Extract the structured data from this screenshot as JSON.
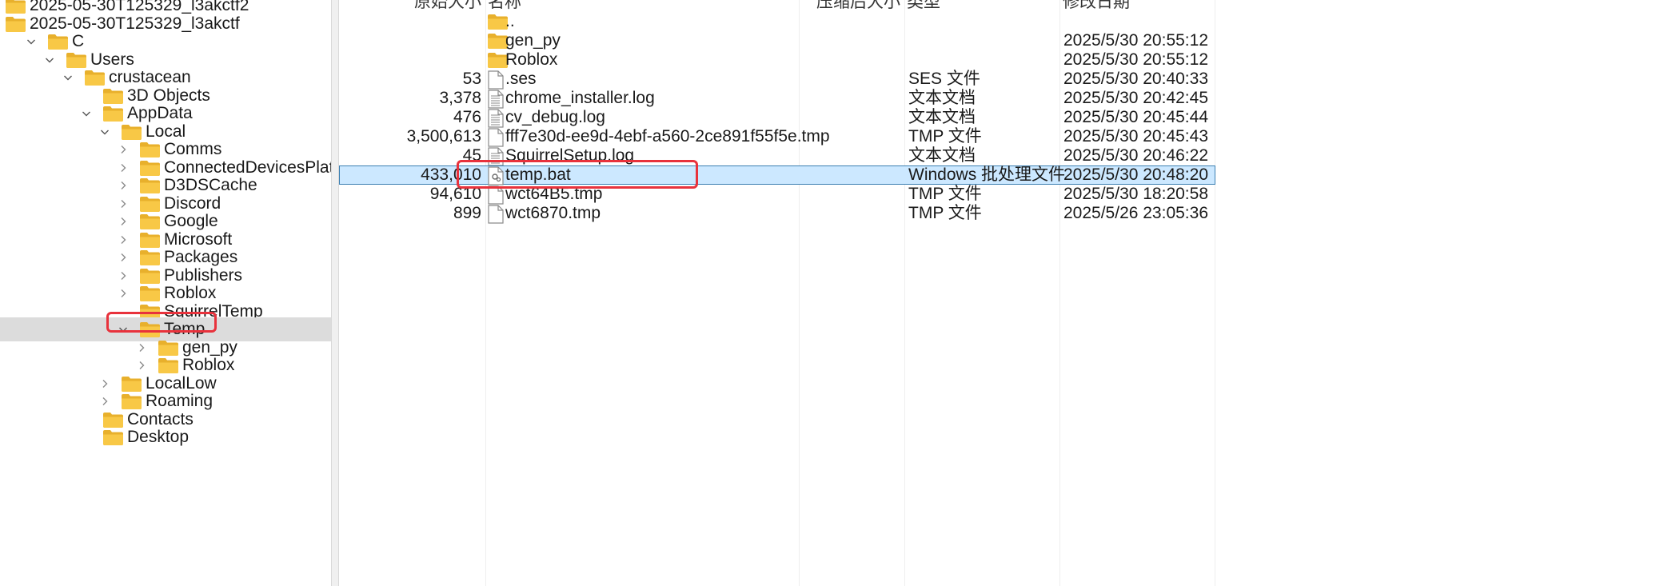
{
  "tree": {
    "items": [
      {
        "label": "2025-05-30T125329_l3akctf2",
        "expand": "none"
      },
      {
        "label": "2025-05-30T125329_l3akctf",
        "expand": "none"
      },
      {
        "label": "C",
        "expand": "open"
      },
      {
        "label": "Users",
        "expand": "open"
      },
      {
        "label": "crustacean",
        "expand": "open"
      },
      {
        "label": "3D Objects",
        "expand": "none"
      },
      {
        "label": "AppData",
        "expand": "open"
      },
      {
        "label": "Local",
        "expand": "open"
      },
      {
        "label": "Comms",
        "expand": "closed"
      },
      {
        "label": "ConnectedDevicesPlatform",
        "expand": "closed"
      },
      {
        "label": "D3DSCache",
        "expand": "closed"
      },
      {
        "label": "Discord",
        "expand": "closed"
      },
      {
        "label": "Google",
        "expand": "closed"
      },
      {
        "label": "Microsoft",
        "expand": "closed"
      },
      {
        "label": "Packages",
        "expand": "closed"
      },
      {
        "label": "Publishers",
        "expand": "closed"
      },
      {
        "label": "Roblox",
        "expand": "closed"
      },
      {
        "label": "SquirrelTemp",
        "expand": "none"
      },
      {
        "label": "Temp",
        "expand": "open"
      },
      {
        "label": "gen_py",
        "expand": "closed"
      },
      {
        "label": "Roblox",
        "expand": "closed"
      },
      {
        "label": "LocalLow",
        "expand": "closed"
      },
      {
        "label": "Roaming",
        "expand": "closed"
      },
      {
        "label": "Contacts",
        "expand": "none"
      },
      {
        "label": "Desktop",
        "expand": "none"
      }
    ]
  },
  "list": {
    "headers": {
      "orig_size": "原始大小",
      "name": "名称",
      "comp_size": "压缩后大小",
      "type": "类型",
      "modified": "修改日期"
    },
    "rows": [
      {
        "size": "",
        "name": "..",
        "icon": "folder-icon",
        "type": "",
        "modified": ""
      },
      {
        "size": "",
        "name": "gen_py",
        "icon": "folder-icon",
        "type": "",
        "modified": "2025/5/30 20:55:12"
      },
      {
        "size": "",
        "name": "Roblox",
        "icon": "folder-icon",
        "type": "",
        "modified": "2025/5/30 20:55:12"
      },
      {
        "size": "53",
        "name": ".ses",
        "icon": "file-icon",
        "type": "SES 文件",
        "modified": "2025/5/30 20:40:33"
      },
      {
        "size": "3,378",
        "name": "chrome_installer.log",
        "icon": "text-file-icon",
        "type": "文本文档",
        "modified": "2025/5/30 20:42:45"
      },
      {
        "size": "476",
        "name": "cv_debug.log",
        "icon": "text-file-icon",
        "type": "文本文档",
        "modified": "2025/5/30 20:45:44"
      },
      {
        "size": "3,500,613",
        "name": "fff7e30d-ee9d-4ebf-a560-2ce891f55f5e.tmp",
        "icon": "file-icon",
        "type": "TMP 文件",
        "modified": "2025/5/30 20:45:43"
      },
      {
        "size": "45",
        "name": "SquirrelSetup.log",
        "icon": "text-file-icon",
        "type": "文本文档",
        "modified": "2025/5/30 20:46:22"
      },
      {
        "size": "433,010",
        "name": "temp.bat",
        "icon": "batch-file-icon",
        "type": "Windows 批处理文件",
        "modified": "2025/5/30 20:48:20"
      },
      {
        "size": "94,610",
        "name": "wct64B5.tmp",
        "icon": "file-icon",
        "type": "TMP 文件",
        "modified": "2025/5/30 18:20:58"
      },
      {
        "size": "899",
        "name": "wct6870.tmp",
        "icon": "file-icon",
        "type": "TMP 文件",
        "modified": "2025/5/26 23:05:36"
      }
    ]
  },
  "colors": {
    "selection_bg": "#cce8ff",
    "selection_border": "#3c7fb1",
    "tree_selected_bg": "#dcdcdc",
    "highlight": "#e8323c",
    "folder": "#f8c846"
  }
}
